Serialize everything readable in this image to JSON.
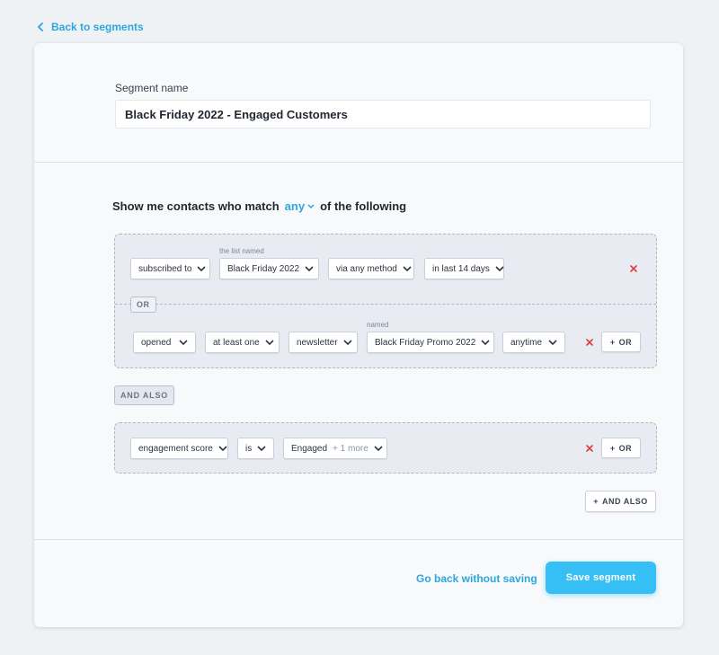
{
  "nav": {
    "back_label": "Back to segments"
  },
  "segment": {
    "name_label": "Segment name",
    "name_value": "Black Friday 2022 - Engaged Customers"
  },
  "match": {
    "prefix": "Show me contacts who match",
    "mode": "any",
    "suffix": "of the following"
  },
  "group1": {
    "row1": {
      "field": "subscribed to",
      "list_caption": "the list named",
      "list": "Black Friday 2022",
      "method": "via any method",
      "period": "in last 14 days"
    },
    "or_tag": "OR",
    "row2": {
      "action": "opened",
      "quantity": "at least one",
      "type": "newsletter",
      "named_caption": "named",
      "name": "Black Friday Promo 2022",
      "time": "anytime"
    },
    "or_button": "OR"
  },
  "and_also_tag": "AND ALSO",
  "group2": {
    "field": "engagement score",
    "operator": "is",
    "value": "Engaged",
    "value_extra": "+ 1 more",
    "or_button": "OR"
  },
  "add_and_also_button": "AND ALSO",
  "footer": {
    "cancel_label": "Go back without saving",
    "save_label": "Save segment"
  },
  "colors": {
    "accent": "#2ea6de",
    "save_button": "#36bff4",
    "remove_icon": "#e23b3b",
    "group_background": "#e8ecf2"
  }
}
